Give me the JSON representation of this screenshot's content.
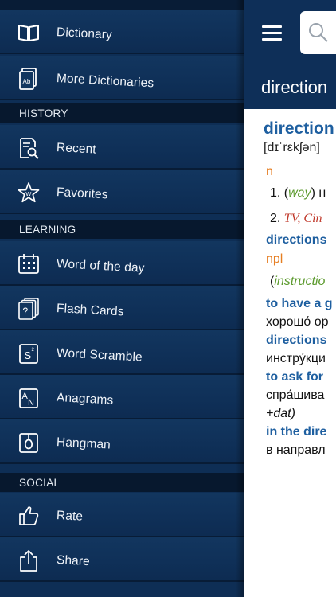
{
  "menu": {
    "top_items": [
      {
        "label": "Dictionary",
        "icon": "book-icon"
      },
      {
        "label": "More Dictionaries",
        "icon": "dictionaries-icon"
      }
    ],
    "history": {
      "title": "HISTORY",
      "items": [
        {
          "label": "Recent",
          "icon": "recent-list-icon"
        },
        {
          "label": "Favorites",
          "icon": "star-icon"
        }
      ]
    },
    "learning": {
      "title": "LEARNING",
      "items": [
        {
          "label": "Word of the day",
          "icon": "calendar-icon"
        },
        {
          "label": "Flash Cards",
          "icon": "flash-cards-icon"
        },
        {
          "label": "Word Scramble",
          "icon": "word-scramble-icon"
        },
        {
          "label": "Anagrams",
          "icon": "anagrams-icon"
        },
        {
          "label": "Hangman",
          "icon": "hangman-icon"
        }
      ]
    },
    "social": {
      "title": "SOCIAL",
      "items": [
        {
          "label": "Rate",
          "icon": "thumbs-up-icon"
        },
        {
          "label": "Share",
          "icon": "share-icon"
        }
      ]
    }
  },
  "header": {
    "current_word": "direction",
    "search_placeholder": ""
  },
  "entry": {
    "headword": "direction",
    "transcription": "[dɪˈrɛkʃən]",
    "pos1": "n",
    "sense1_num": "1.",
    "sense1_open": "(",
    "sense1_label": "way",
    "sense1_close": ") н",
    "sense2_num": "2.",
    "sense2_text": "TV, Cin",
    "phrase1": "directions",
    "pos2": "npl",
    "phrase1_open": "(",
    "phrase1_label": "instructio",
    "phrase2": "to have a g",
    "phrase2_tr": "хорошо́ ор",
    "phrase3": "directions",
    "phrase3_tr": "инстру́кци",
    "phrase4": "to ask for",
    "phrase4_tr": "спра́шива",
    "phrase4_note": "+dat)",
    "phrase5": "in the dire",
    "phrase5_tr": "в направл"
  }
}
